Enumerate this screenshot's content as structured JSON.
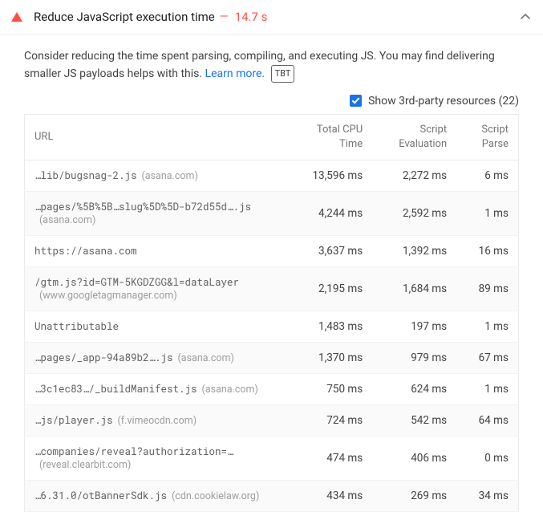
{
  "header": {
    "title": "Reduce JavaScript execution time",
    "dash": "—",
    "time": "14.7 s"
  },
  "description": {
    "text_before": "Consider reducing the time spent parsing, compiling, and executing JS. You may find delivering smaller JS payloads helps with this. ",
    "link": "Learn more.",
    "badge": "TBT"
  },
  "toggle": {
    "label": "Show 3rd-party resources (22)"
  },
  "columns": {
    "url": "URL",
    "cpu_l1": "Total CPU",
    "cpu_l2": "Time",
    "eval_l1": "Script",
    "eval_l2": "Evaluation",
    "parse_l1": "Script",
    "parse_l2": "Parse"
  },
  "rows": [
    {
      "path": "…lib/bugsnag-2.js",
      "domain": "(asana.com)",
      "cpu": "13,596 ms",
      "eval": "2,272 ms",
      "parse": "6 ms"
    },
    {
      "path": "…pages/%5B%5B…slug%5D%5D-b72d55d….js",
      "domain": "(asana.com)",
      "cpu": "4,244 ms",
      "eval": "2,592 ms",
      "parse": "1 ms"
    },
    {
      "path": "https://asana.com",
      "domain": "",
      "cpu": "3,637 ms",
      "eval": "1,392 ms",
      "parse": "16 ms"
    },
    {
      "path": "/gtm.js?id=GTM-5KGDZGG&l=dataLayer",
      "domain": "(www.googletagmanager.com)",
      "cpu": "2,195 ms",
      "eval": "1,684 ms",
      "parse": "89 ms"
    },
    {
      "path": "Unattributable",
      "domain": "",
      "cpu": "1,483 ms",
      "eval": "197 ms",
      "parse": "1 ms"
    },
    {
      "path": "…pages/_app-94a89b2….js",
      "domain": "(asana.com)",
      "cpu": "1,370 ms",
      "eval": "979 ms",
      "parse": "67 ms"
    },
    {
      "path": "…3c1ec83…/_buildManifest.js",
      "domain": "(asana.com)",
      "cpu": "750 ms",
      "eval": "624 ms",
      "parse": "1 ms"
    },
    {
      "path": "…js/player.js",
      "domain": "(f.vimeocdn.com)",
      "cpu": "724 ms",
      "eval": "542 ms",
      "parse": "64 ms"
    },
    {
      "path": "…companies/reveal?authorization=…",
      "domain": "(reveal.clearbit.com)",
      "cpu": "474 ms",
      "eval": "406 ms",
      "parse": "0 ms"
    },
    {
      "path": "…6.31.0/otBannerSdk.js",
      "domain": "(cdn.cookielaw.org)",
      "cpu": "434 ms",
      "eval": "269 ms",
      "parse": "34 ms"
    }
  ]
}
